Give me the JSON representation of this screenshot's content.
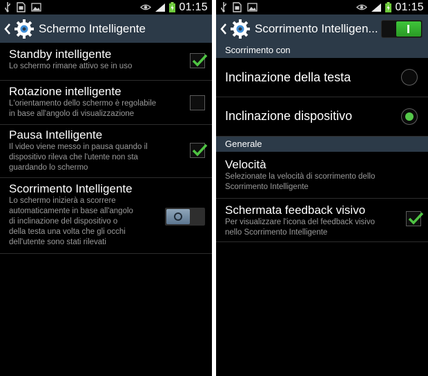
{
  "status_bar": {
    "time": "01:15",
    "icons": [
      "usb-icon",
      "sim-icon",
      "image-icon",
      "eye-icon",
      "signal-icon",
      "battery-charging-icon"
    ]
  },
  "left_screen": {
    "title": "Schermo Intelligente",
    "items": [
      {
        "title": "Standby intelligente",
        "summary": [
          "Lo schermo rimane attivo se in uso"
        ],
        "control": "checkbox",
        "checked": true
      },
      {
        "title": "Rotazione intelligente",
        "summary": [
          "L'orientamento dello schermo è regolabile",
          "in base all'angolo di visualizzazione"
        ],
        "control": "checkbox",
        "checked": false
      },
      {
        "title": "Pausa Intelligente",
        "summary": [
          "Il video viene messo in pausa quando il",
          "dispositivo rileva che l'utente non sta",
          "guardando lo schermo"
        ],
        "control": "checkbox",
        "checked": true
      },
      {
        "title": "Scorrimento Intelligente",
        "summary": [
          "Lo schermo inizierà a scorrere",
          "automaticamente in base all'angolo",
          "di inclinazione del dispositivo o",
          "della testa una volta che gli occhi",
          "dell'utente sono stati rilevati"
        ],
        "control": "switch",
        "on": false
      }
    ]
  },
  "right_screen": {
    "title": "Scorrimento Intelligen...",
    "master_switch_on": true,
    "section_scroll": "Scorrimento con",
    "radio_options": [
      {
        "label": "Inclinazione della testa",
        "selected": false
      },
      {
        "label": "Inclinazione dispositivo",
        "selected": true
      }
    ],
    "section_general": "Generale",
    "speed": {
      "title": "Velocità",
      "summary": [
        "Selezionate la velocità di scorrimento dello",
        "Scorrimento Intelligente"
      ]
    },
    "feedback": {
      "title": "Schermata feedback visivo",
      "summary": [
        "Per visualizzare l'icona del feedback visivo",
        "nello Scorrimento Intelligente"
      ],
      "checked": true
    }
  },
  "colors": {
    "action_bar": "#2c3a48",
    "accent_green": "#55c84a",
    "summary_text": "#9a9a9a",
    "divider": "#2d2d2d"
  }
}
